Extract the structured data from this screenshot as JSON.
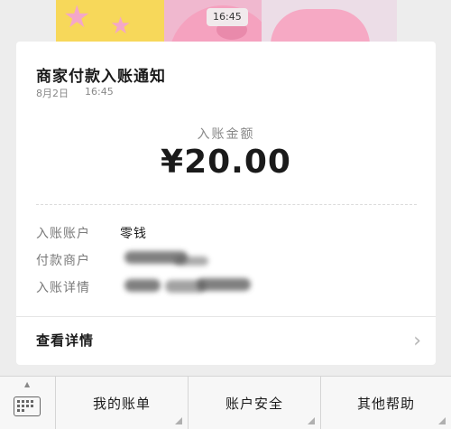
{
  "status_bar": {
    "time": "16:45"
  },
  "card": {
    "title": "商家付款入账通知",
    "date": "8月2日",
    "time": "16:45",
    "amount_label": "入账金额",
    "amount": "¥20.00",
    "rows": [
      {
        "label": "入账账户",
        "value": "零钱"
      },
      {
        "label": "付款商户",
        "value": ""
      },
      {
        "label": "入账详情",
        "value": ""
      }
    ],
    "detail_link": "查看详情"
  },
  "menu": {
    "items": [
      "我的账单",
      "账户安全",
      "其他帮助"
    ]
  },
  "icons": [
    "keyboard-icon",
    "chevron-right-icon",
    "submenu-corner-icon",
    "expand-arrow-icon"
  ]
}
